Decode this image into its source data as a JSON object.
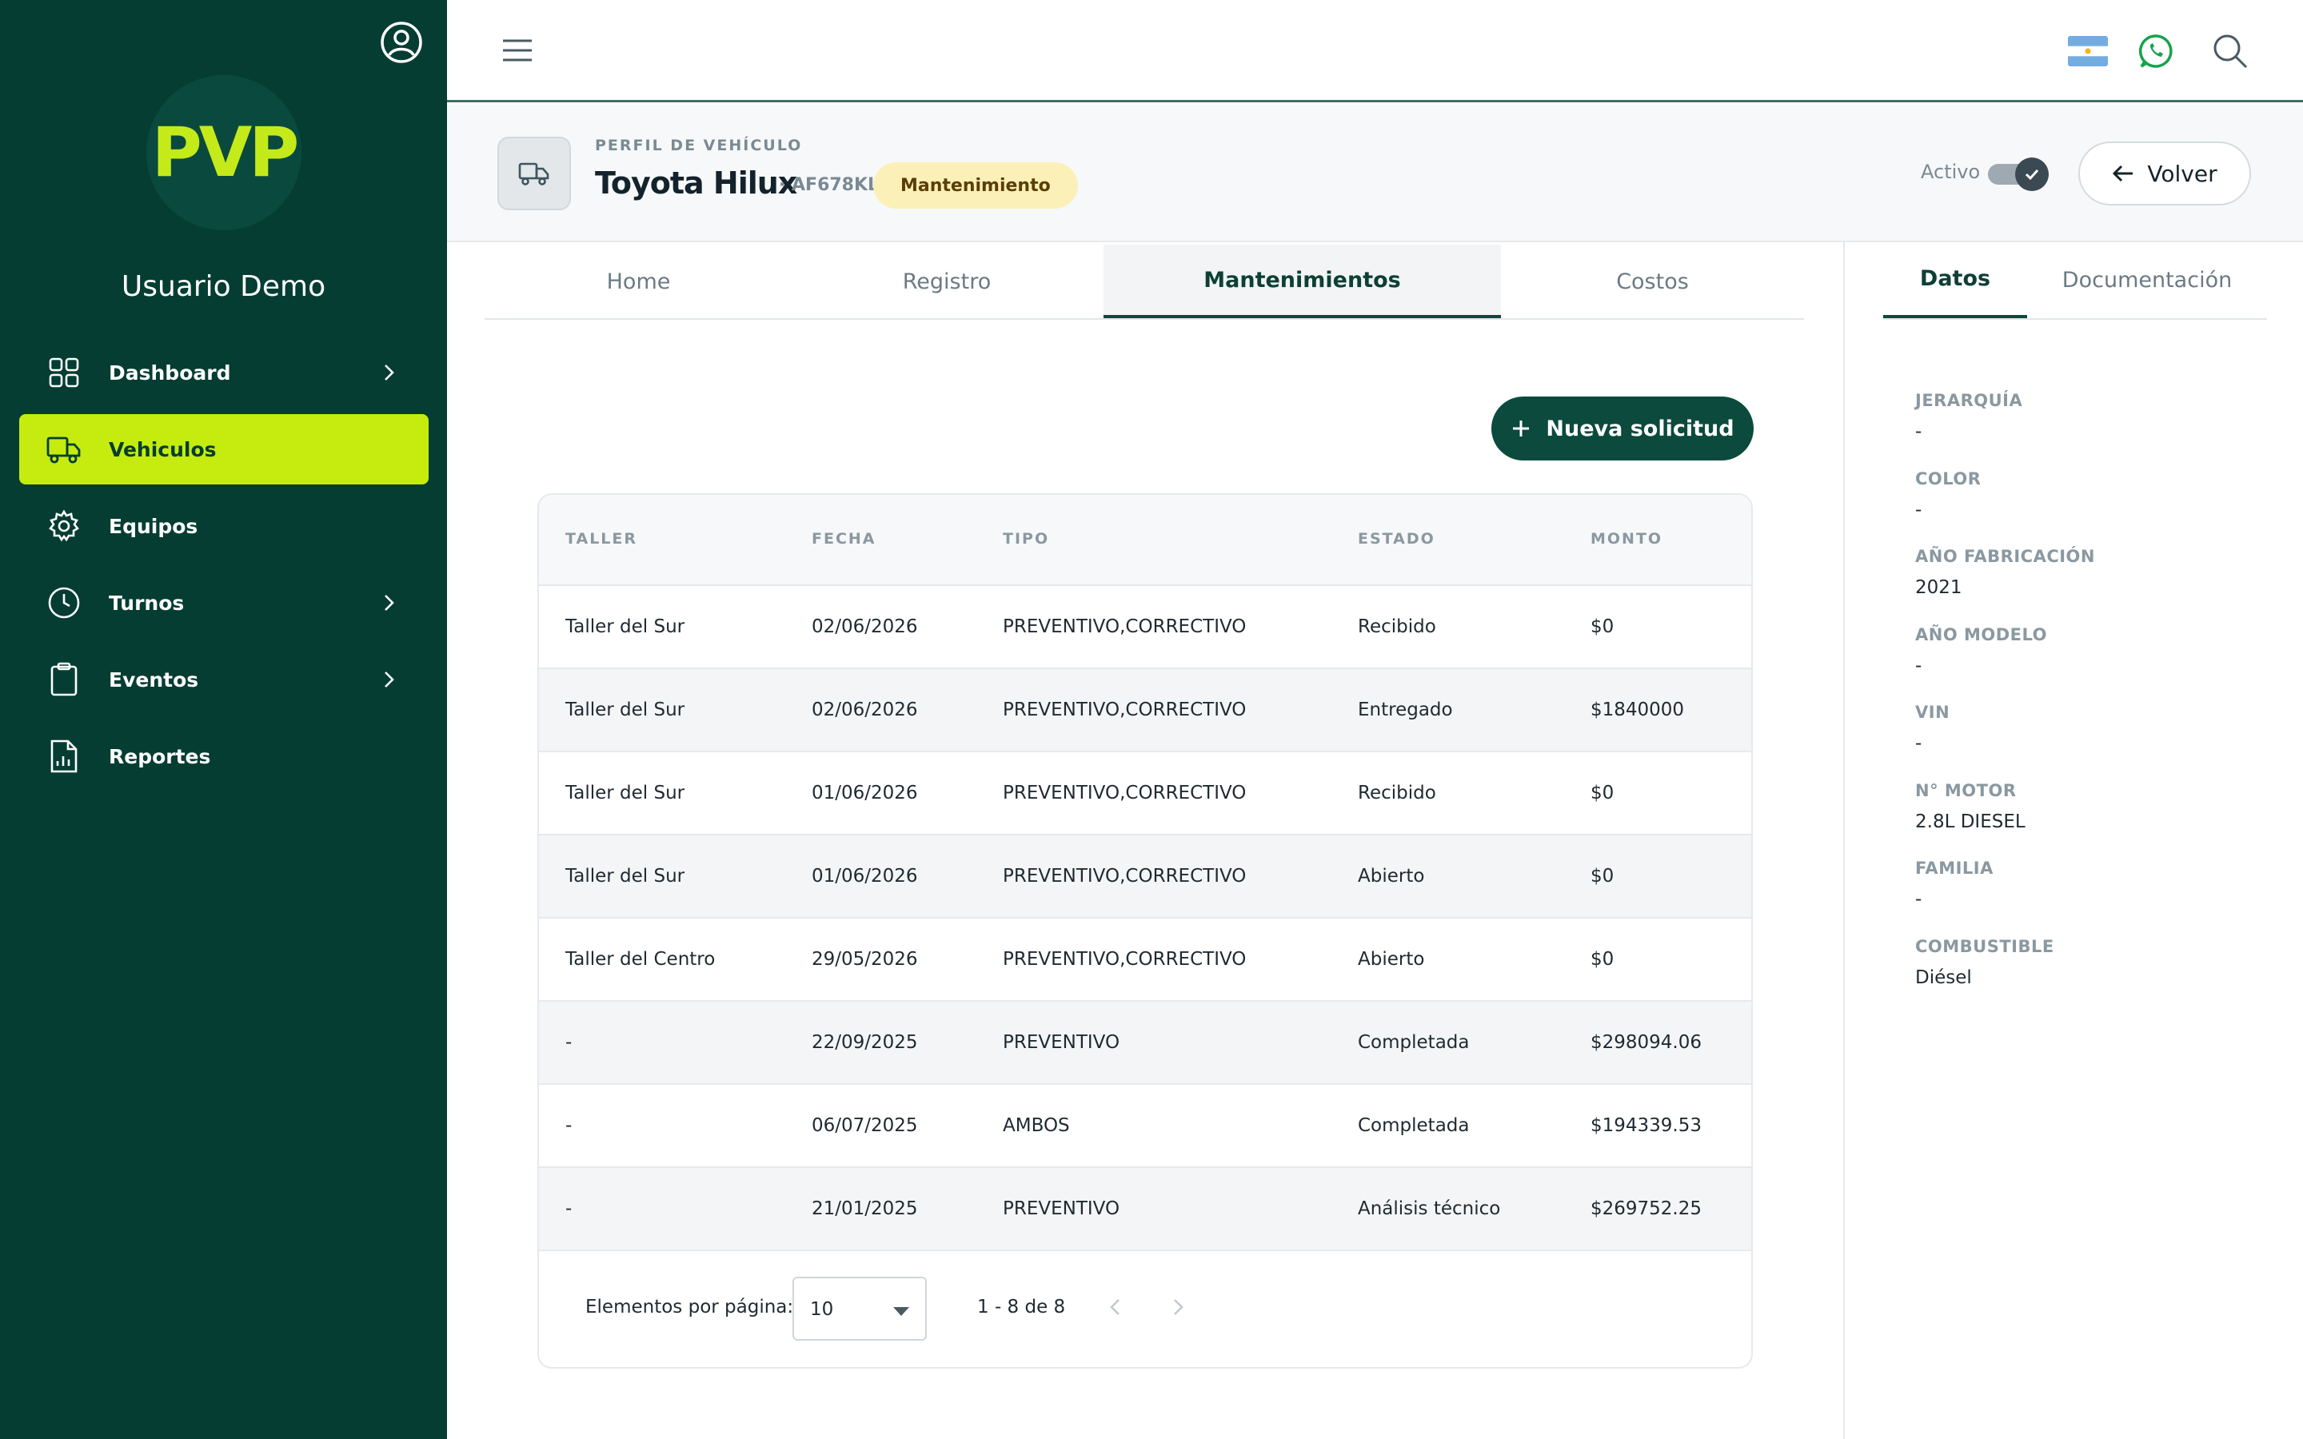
{
  "app": {
    "logo_text": "PVP",
    "user_name": "Usuario Demo"
  },
  "sidebar": {
    "items": [
      {
        "label": "Dashboard",
        "icon": "grid-icon",
        "has_chevron": true
      },
      {
        "label": "Vehiculos",
        "icon": "truck-icon",
        "active": true
      },
      {
        "label": "Equipos",
        "icon": "gear-icon"
      },
      {
        "label": "Turnos",
        "icon": "clock-icon",
        "has_chevron": true
      },
      {
        "label": "Eventos",
        "icon": "clipboard-icon",
        "has_chevron": true
      },
      {
        "label": "Reportes",
        "icon": "report-icon"
      }
    ]
  },
  "topbar": {
    "icons": [
      "menu-icon",
      "argentina-flag-icon",
      "whatsapp-icon",
      "search-icon"
    ]
  },
  "header": {
    "eyebrow": "PERFIL DE VEHÍCULO",
    "title": "Toyota Hilux",
    "plate": "· AF678KL",
    "status": "Mantenimiento",
    "active_label": "Activo",
    "active_on": true,
    "back_label": "Volver"
  },
  "tabs": [
    {
      "label": "Home"
    },
    {
      "label": "Registro"
    },
    {
      "label": "Mantenimientos",
      "active": true
    },
    {
      "label": "Costos"
    }
  ],
  "actions": {
    "new_request_label": "Nueva solicitud"
  },
  "table": {
    "columns": [
      "TALLER",
      "FECHA",
      "TIPO",
      "ESTADO",
      "MONTO"
    ],
    "rows": [
      {
        "taller": "Taller del Sur",
        "fecha": "02/06/2026",
        "tipo": "PREVENTIVO,CORRECTIVO",
        "estado": "Recibido",
        "monto": "$0"
      },
      {
        "taller": "Taller del Sur",
        "fecha": "02/06/2026",
        "tipo": "PREVENTIVO,CORRECTIVO",
        "estado": "Entregado",
        "monto": "$1840000"
      },
      {
        "taller": "Taller del Sur",
        "fecha": "01/06/2026",
        "tipo": "PREVENTIVO,CORRECTIVO",
        "estado": "Recibido",
        "monto": "$0"
      },
      {
        "taller": "Taller del Sur",
        "fecha": "01/06/2026",
        "tipo": "PREVENTIVO,CORRECTIVO",
        "estado": "Abierto",
        "monto": "$0"
      },
      {
        "taller": "Taller del Centro",
        "fecha": "29/05/2026",
        "tipo": "PREVENTIVO,CORRECTIVO",
        "estado": "Abierto",
        "monto": "$0"
      },
      {
        "taller": "-",
        "fecha": "22/09/2025",
        "tipo": "PREVENTIVO",
        "estado": "Completada",
        "monto": "$298094.06"
      },
      {
        "taller": "-",
        "fecha": "06/07/2025",
        "tipo": "AMBOS",
        "estado": "Completada",
        "monto": "$194339.53"
      },
      {
        "taller": "-",
        "fecha": "21/01/2025",
        "tipo": "PREVENTIVO",
        "estado": "Análisis técnico",
        "monto": "$269752.25"
      }
    ]
  },
  "pagination": {
    "label": "Elementos por página:",
    "page_size": "10",
    "range": "1 - 8 de 8"
  },
  "right_panel": {
    "tabs": [
      {
        "label": "Datos",
        "active": true
      },
      {
        "label": "Documentación"
      }
    ],
    "fields": [
      {
        "key": "JERARQUÍA",
        "value": "-"
      },
      {
        "key": "COLOR",
        "value": "-"
      },
      {
        "key": "AÑO FABRICACIÓN",
        "value": "2021"
      },
      {
        "key": "AÑO MODELO",
        "value": "-"
      },
      {
        "key": "VIN",
        "value": "-"
      },
      {
        "key": "N° MOTOR",
        "value": "2.8L DIESEL"
      },
      {
        "key": "FAMILIA",
        "value": "-"
      },
      {
        "key": "COMBUSTIBLE",
        "value": "Diésel"
      }
    ]
  },
  "colors": {
    "sidebar_bg": "#053d33",
    "accent_lime": "#c5ec0e",
    "primary_green": "#0b4a3d",
    "status_pill_bg": "#fbf0b8"
  }
}
